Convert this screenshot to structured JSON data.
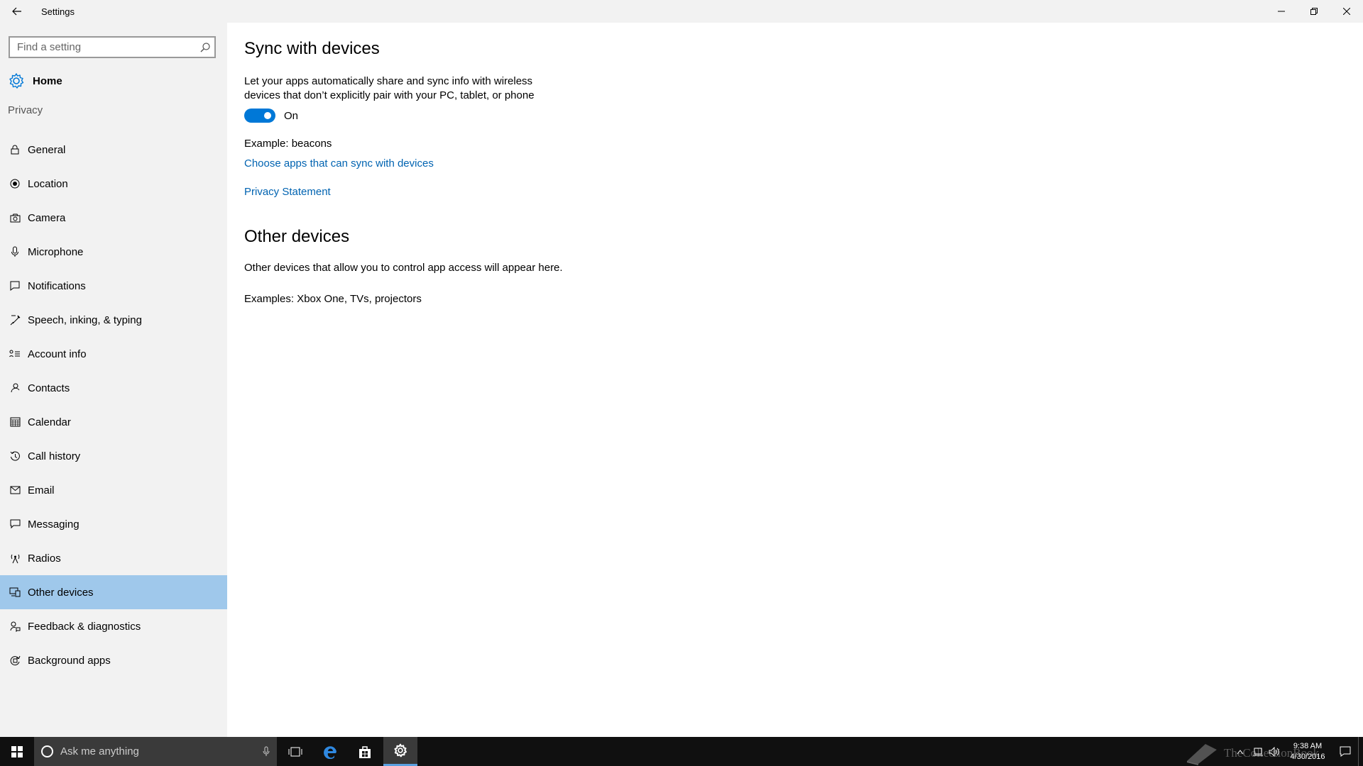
{
  "window": {
    "title": "Settings"
  },
  "sidebar": {
    "search_placeholder": "Find a setting",
    "home_label": "Home",
    "section_label": "Privacy",
    "items": [
      {
        "label": "General",
        "icon": "lock-icon",
        "selected": false
      },
      {
        "label": "Location",
        "icon": "location-icon",
        "selected": false
      },
      {
        "label": "Camera",
        "icon": "camera-icon",
        "selected": false
      },
      {
        "label": "Microphone",
        "icon": "microphone-icon",
        "selected": false
      },
      {
        "label": "Notifications",
        "icon": "notification-icon",
        "selected": false
      },
      {
        "label": "Speech, inking, & typing",
        "icon": "speech-icon",
        "selected": false
      },
      {
        "label": "Account info",
        "icon": "account-icon",
        "selected": false
      },
      {
        "label": "Contacts",
        "icon": "contacts-icon",
        "selected": false
      },
      {
        "label": "Calendar",
        "icon": "calendar-icon",
        "selected": false
      },
      {
        "label": "Call history",
        "icon": "history-icon",
        "selected": false
      },
      {
        "label": "Email",
        "icon": "email-icon",
        "selected": false
      },
      {
        "label": "Messaging",
        "icon": "message-icon",
        "selected": false
      },
      {
        "label": "Radios",
        "icon": "radio-icon",
        "selected": false
      },
      {
        "label": "Other devices",
        "icon": "devices-icon",
        "selected": true
      },
      {
        "label": "Feedback & diagnostics",
        "icon": "feedback-icon",
        "selected": false
      },
      {
        "label": "Background apps",
        "icon": "background-apps-icon",
        "selected": false
      }
    ]
  },
  "main": {
    "sync_heading": "Sync with devices",
    "sync_description": "Let your apps automatically share and sync info with wireless devices that don’t explicitly pair with your PC, tablet, or phone",
    "toggle_state": "On",
    "example_text": "Example: beacons",
    "choose_apps_link": "Choose apps that can sync with devices",
    "privacy_link": "Privacy Statement",
    "other_heading": "Other devices",
    "other_description": "Other devices that allow you to control app access will appear here.",
    "other_examples": "Examples: Xbox One, TVs, projectors"
  },
  "taskbar": {
    "search_text": "Ask me anything",
    "time": "9:38 AM",
    "date": "4/30/2016",
    "watermark": "TheCollectionBook"
  },
  "colors": {
    "accent": "#0078d7",
    "link": "#0063b1",
    "selected_bg": "#9fc8eb",
    "sidebar_bg": "#f2f2f2",
    "taskbar_bg": "#101010"
  }
}
